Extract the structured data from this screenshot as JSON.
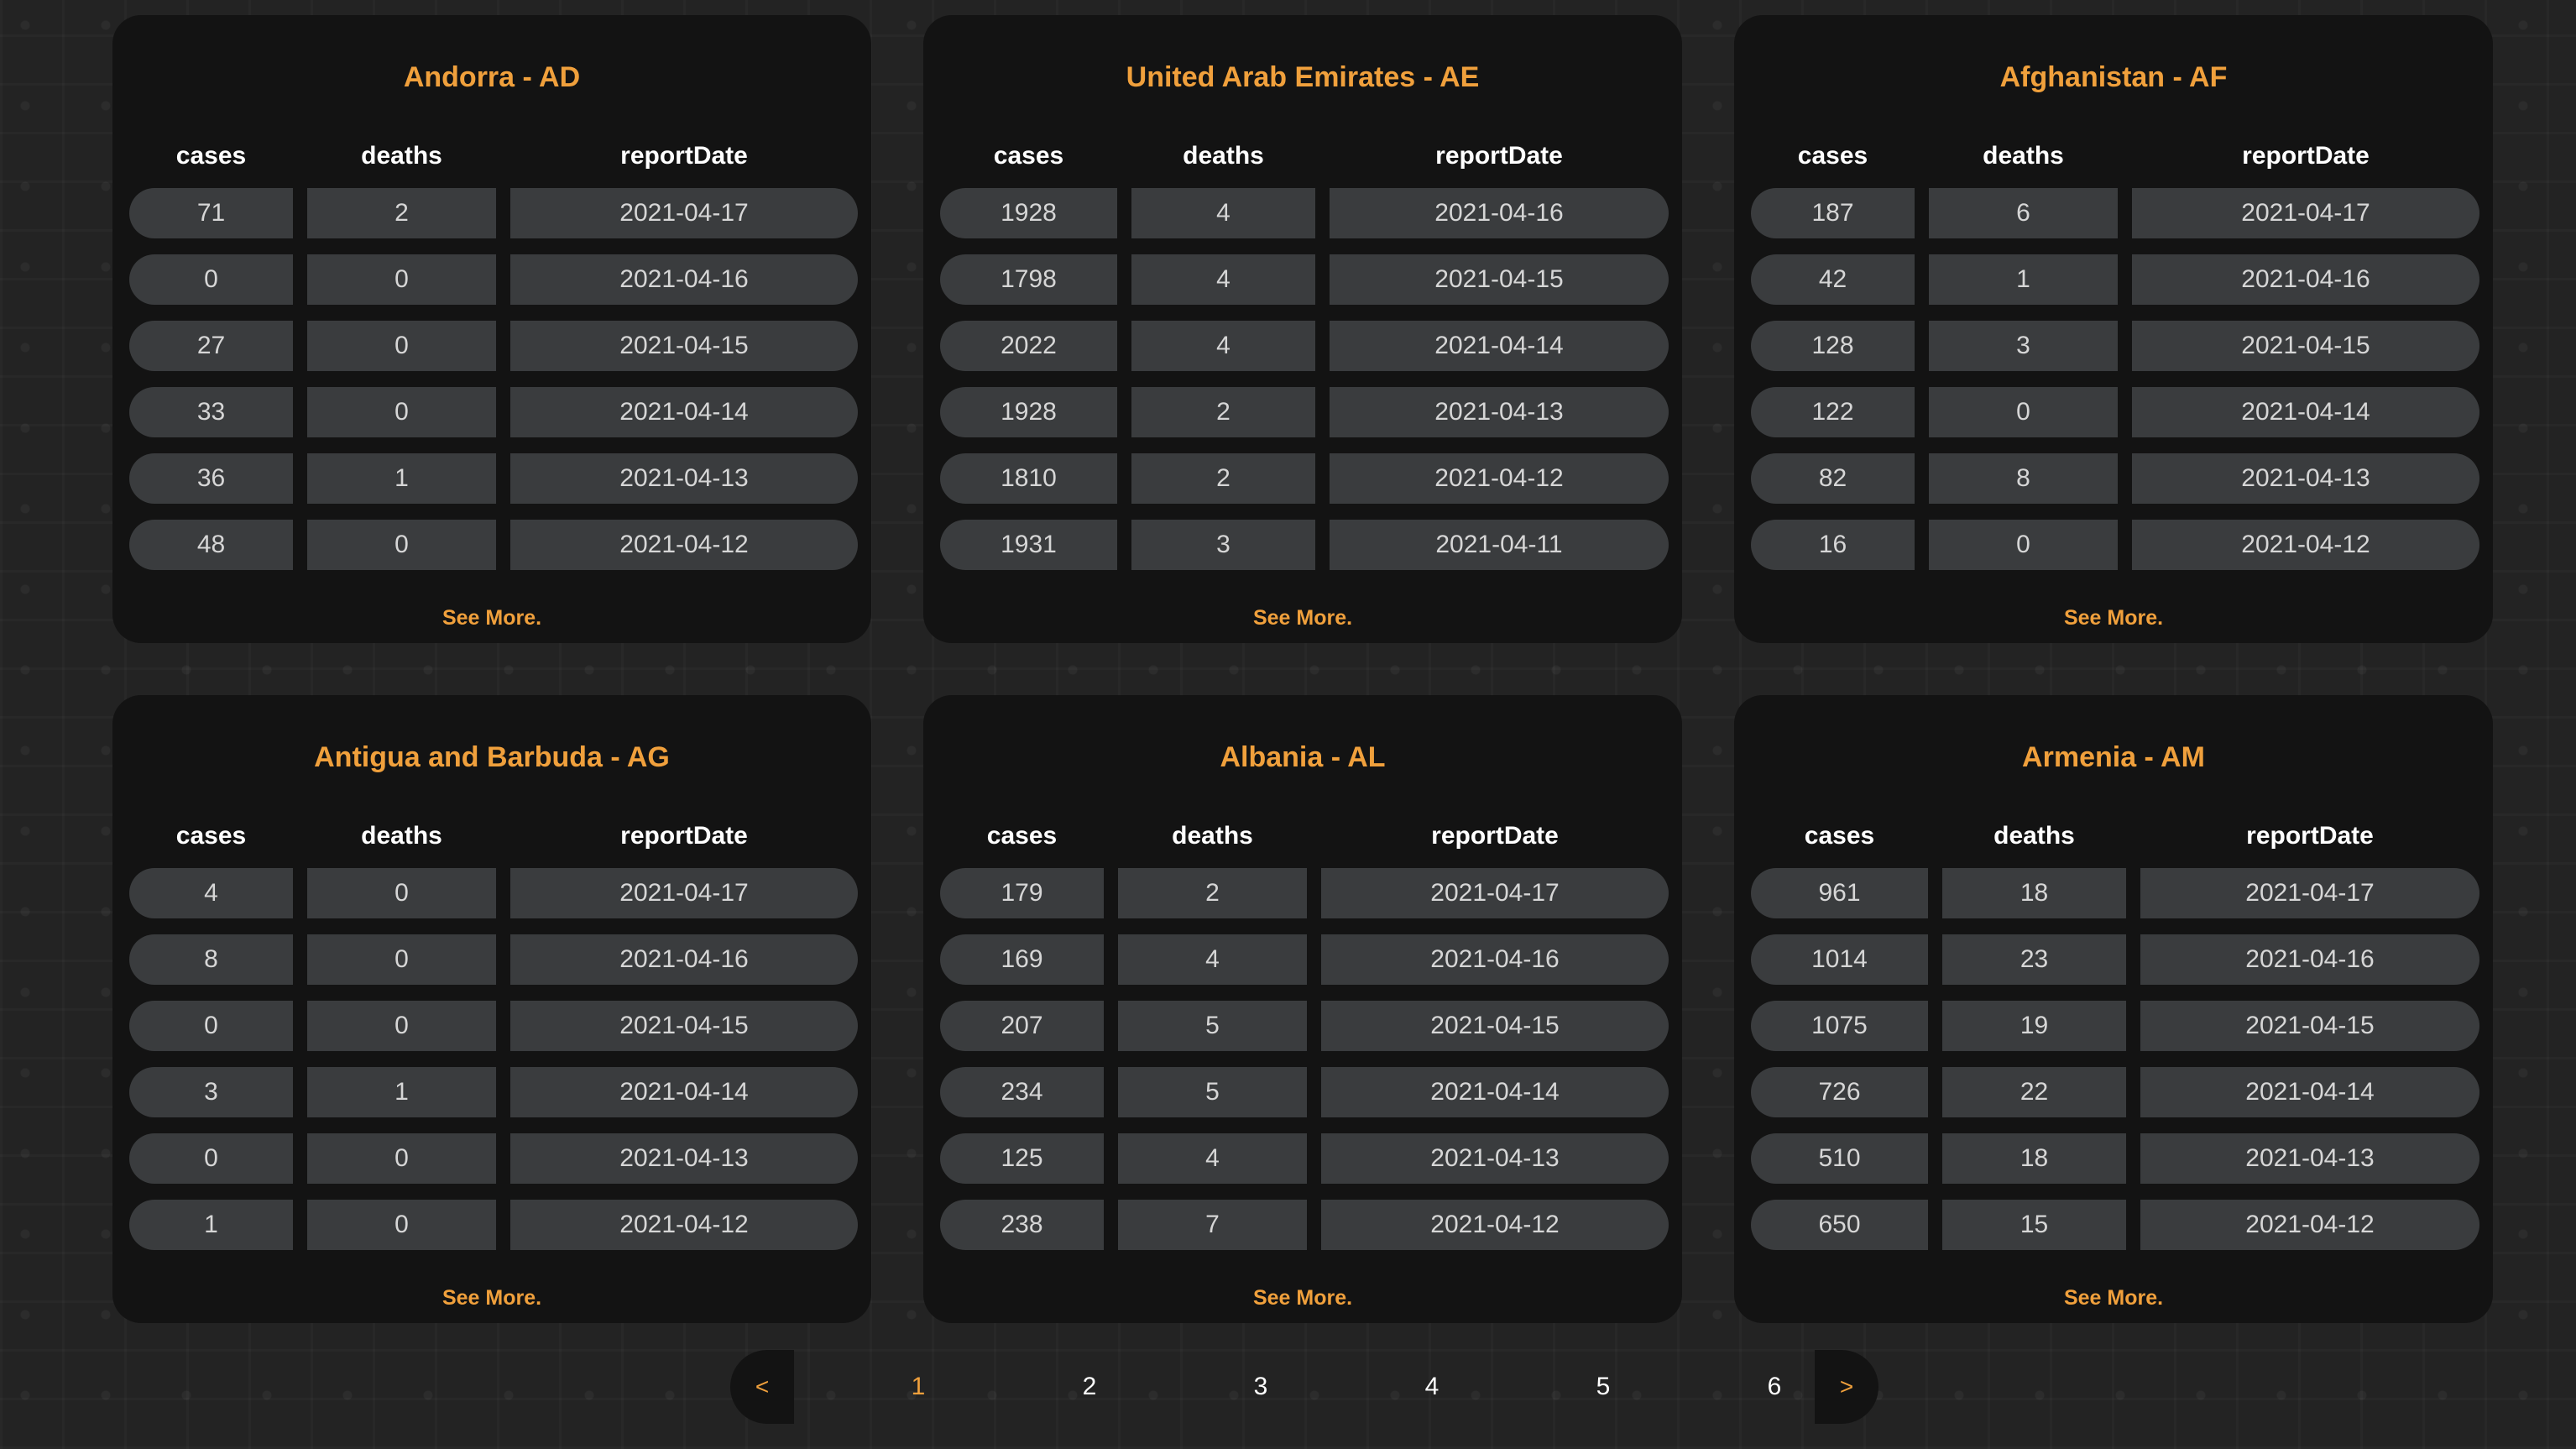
{
  "accent_color": "#f0a03c",
  "columns": [
    "cases",
    "deaths",
    "reportDate"
  ],
  "see_more_label": "See More.",
  "cards": [
    {
      "title": "Andorra - AD",
      "rows": [
        [
          "71",
          "2",
          "2021-04-17"
        ],
        [
          "0",
          "0",
          "2021-04-16"
        ],
        [
          "27",
          "0",
          "2021-04-15"
        ],
        [
          "33",
          "0",
          "2021-04-14"
        ],
        [
          "36",
          "1",
          "2021-04-13"
        ],
        [
          "48",
          "0",
          "2021-04-12"
        ]
      ]
    },
    {
      "title": "United Arab Emirates - AE",
      "rows": [
        [
          "1928",
          "4",
          "2021-04-16"
        ],
        [
          "1798",
          "4",
          "2021-04-15"
        ],
        [
          "2022",
          "4",
          "2021-04-14"
        ],
        [
          "1928",
          "2",
          "2021-04-13"
        ],
        [
          "1810",
          "2",
          "2021-04-12"
        ],
        [
          "1931",
          "3",
          "2021-04-11"
        ]
      ]
    },
    {
      "title": "Afghanistan - AF",
      "rows": [
        [
          "187",
          "6",
          "2021-04-17"
        ],
        [
          "42",
          "1",
          "2021-04-16"
        ],
        [
          "128",
          "3",
          "2021-04-15"
        ],
        [
          "122",
          "0",
          "2021-04-14"
        ],
        [
          "82",
          "8",
          "2021-04-13"
        ],
        [
          "16",
          "0",
          "2021-04-12"
        ]
      ]
    },
    {
      "title": "Antigua and Barbuda - AG",
      "rows": [
        [
          "4",
          "0",
          "2021-04-17"
        ],
        [
          "8",
          "0",
          "2021-04-16"
        ],
        [
          "0",
          "0",
          "2021-04-15"
        ],
        [
          "3",
          "1",
          "2021-04-14"
        ],
        [
          "0",
          "0",
          "2021-04-13"
        ],
        [
          "1",
          "0",
          "2021-04-12"
        ]
      ]
    },
    {
      "title": "Albania - AL",
      "rows": [
        [
          "179",
          "2",
          "2021-04-17"
        ],
        [
          "169",
          "4",
          "2021-04-16"
        ],
        [
          "207",
          "5",
          "2021-04-15"
        ],
        [
          "234",
          "5",
          "2021-04-14"
        ],
        [
          "125",
          "4",
          "2021-04-13"
        ],
        [
          "238",
          "7",
          "2021-04-12"
        ]
      ]
    },
    {
      "title": "Armenia - AM",
      "rows": [
        [
          "961",
          "18",
          "2021-04-17"
        ],
        [
          "1014",
          "23",
          "2021-04-16"
        ],
        [
          "1075",
          "19",
          "2021-04-15"
        ],
        [
          "726",
          "22",
          "2021-04-14"
        ],
        [
          "510",
          "18",
          "2021-04-13"
        ],
        [
          "650",
          "15",
          "2021-04-12"
        ]
      ]
    }
  ],
  "pagination": {
    "prev_label": "<",
    "next_label": ">",
    "pages": [
      "1",
      "2",
      "3",
      "4",
      "5",
      "6"
    ],
    "active_page": "1"
  }
}
